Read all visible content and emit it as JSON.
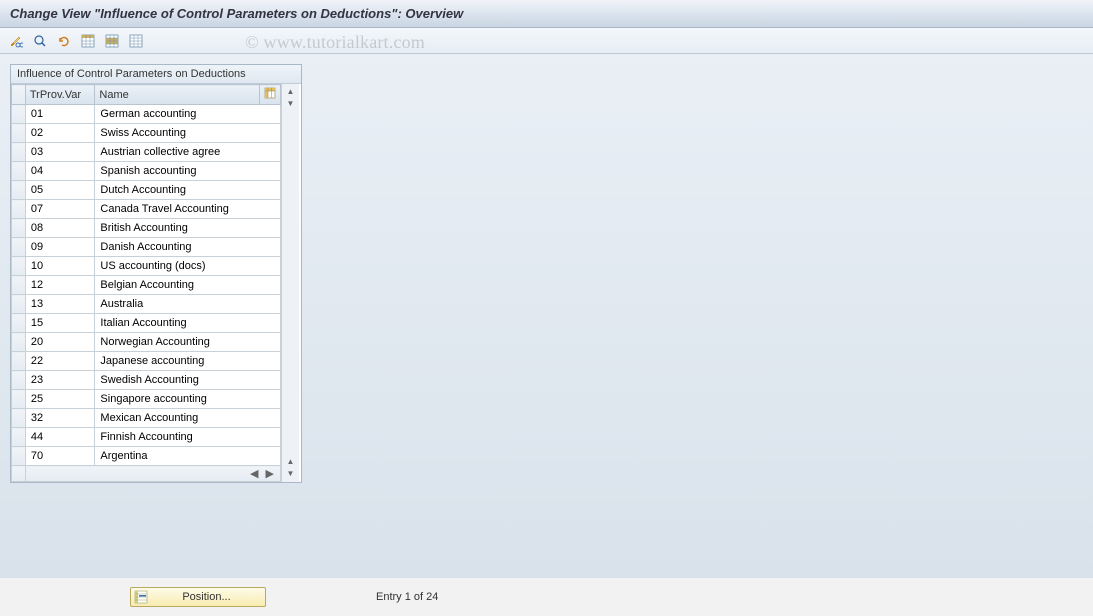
{
  "header": {
    "title": "Change View \"Influence of Control Parameters on Deductions\": Overview"
  },
  "watermark": "www.tutorialkart.com",
  "table": {
    "caption": "Influence of Control Parameters on Deductions",
    "columns": {
      "code": "TrProv.Var",
      "name": "Name"
    },
    "rows": [
      {
        "code": "01",
        "name": "German accounting"
      },
      {
        "code": "02",
        "name": "Swiss Accounting"
      },
      {
        "code": "03",
        "name": "Austrian collective agree"
      },
      {
        "code": "04",
        "name": "Spanish accounting"
      },
      {
        "code": "05",
        "name": "Dutch Accounting"
      },
      {
        "code": "07",
        "name": "Canada Travel Accounting"
      },
      {
        "code": "08",
        "name": "British Accounting"
      },
      {
        "code": "09",
        "name": "Danish Accounting"
      },
      {
        "code": "10",
        "name": "US accounting (docs)"
      },
      {
        "code": "12",
        "name": "Belgian Accounting"
      },
      {
        "code": "13",
        "name": "Australia"
      },
      {
        "code": "15",
        "name": "Italian Accounting"
      },
      {
        "code": "20",
        "name": "Norwegian Accounting"
      },
      {
        "code": "22",
        "name": "Japanese accounting"
      },
      {
        "code": "23",
        "name": "Swedish Accounting"
      },
      {
        "code": "25",
        "name": "Singapore accounting"
      },
      {
        "code": "32",
        "name": "Mexican Accounting"
      },
      {
        "code": "44",
        "name": "Finnish Accounting"
      },
      {
        "code": "70",
        "name": "Argentina"
      }
    ]
  },
  "footer": {
    "position_label": "Position...",
    "entry_text": "Entry 1 of 24"
  },
  "icons": {
    "toggle": "toggle-display",
    "details": "details",
    "undo": "undo-change",
    "select_all": "select-all",
    "select_block": "select-block",
    "deselect_all": "deselect-all",
    "config_col": "configure-columns"
  }
}
